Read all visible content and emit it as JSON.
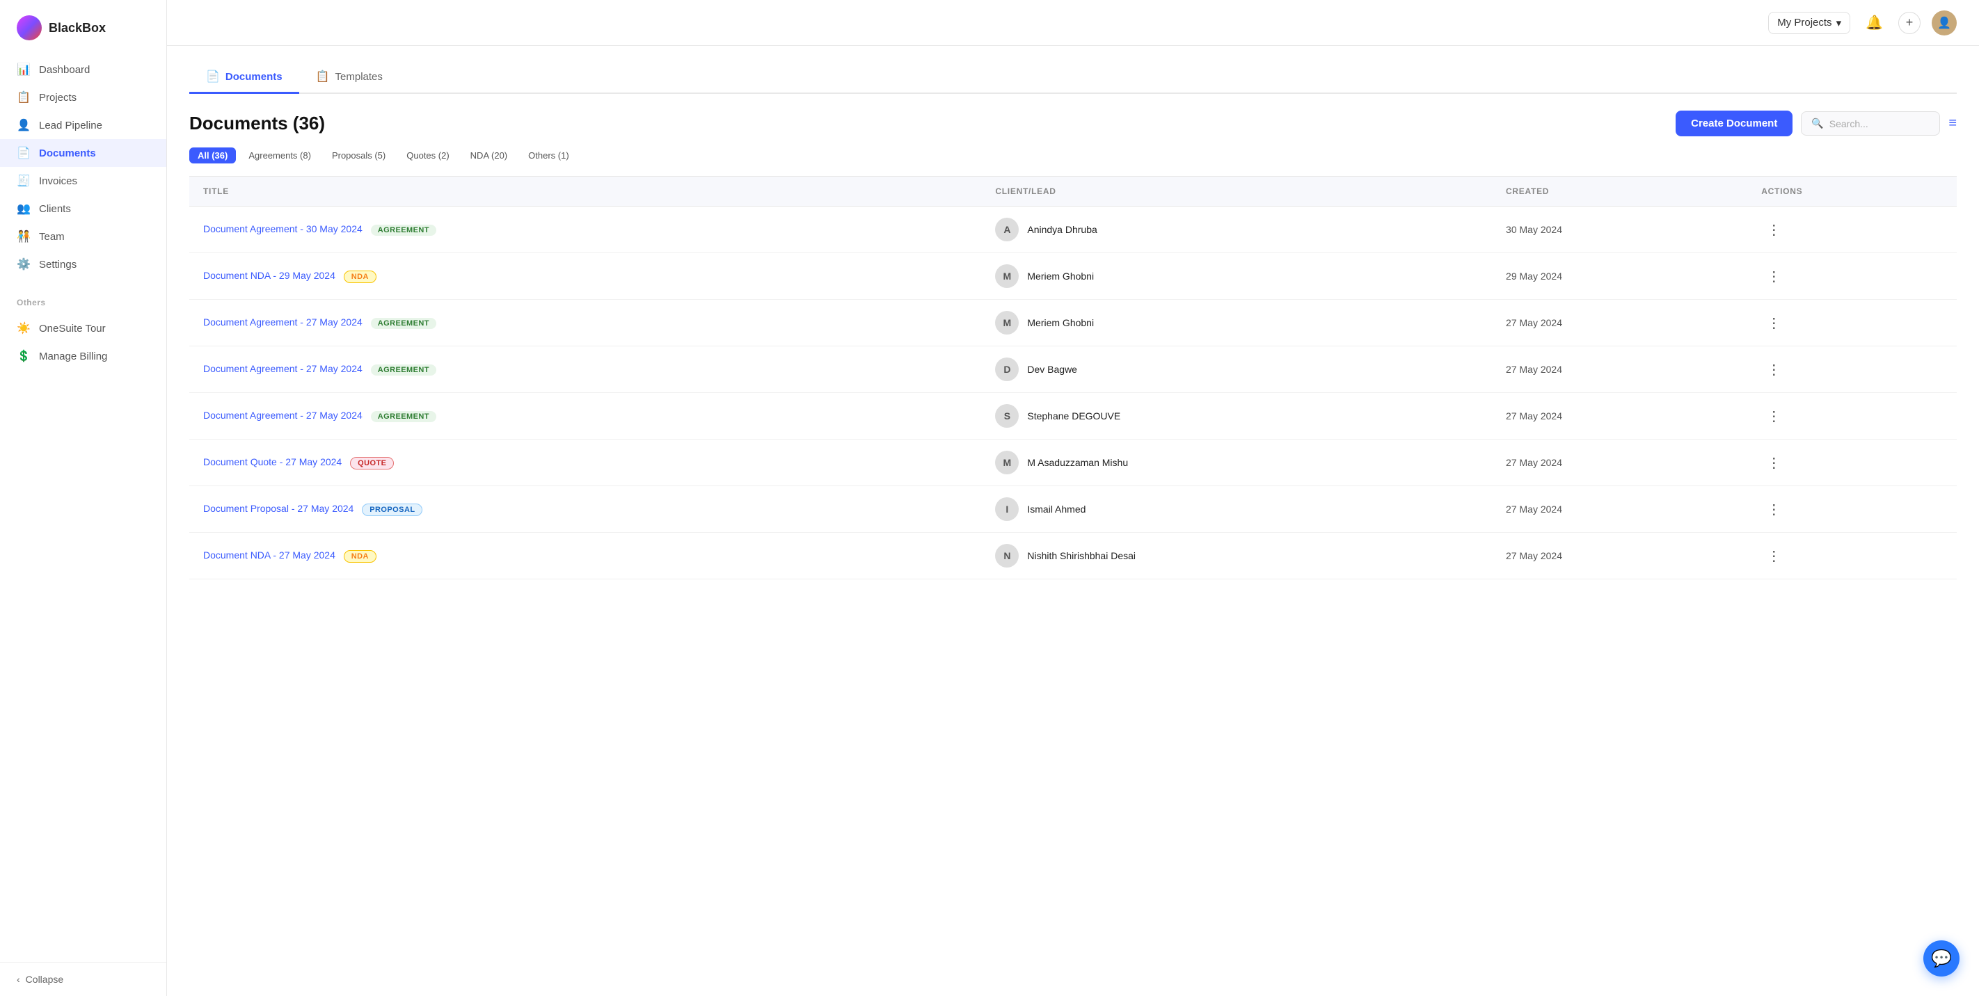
{
  "app": {
    "name": "BlackBox"
  },
  "topbar": {
    "projects_label": "My Projects",
    "chevron": "▾",
    "plus_icon": "+",
    "bell_icon": "🔔"
  },
  "sidebar": {
    "nav_items": [
      {
        "id": "dashboard",
        "label": "Dashboard",
        "icon": "📊",
        "active": false
      },
      {
        "id": "projects",
        "label": "Projects",
        "icon": "📋",
        "active": false
      },
      {
        "id": "lead-pipeline",
        "label": "Lead Pipeline",
        "icon": "👤",
        "active": false
      },
      {
        "id": "documents",
        "label": "Documents",
        "icon": "📄",
        "active": true
      },
      {
        "id": "invoices",
        "label": "Invoices",
        "icon": "🧾",
        "active": false
      },
      {
        "id": "clients",
        "label": "Clients",
        "icon": "👥",
        "active": false
      },
      {
        "id": "team",
        "label": "Team",
        "icon": "🧑‍🤝‍🧑",
        "active": false
      },
      {
        "id": "settings",
        "label": "Settings",
        "icon": "⚙️",
        "active": false
      }
    ],
    "others_label": "Others",
    "others_items": [
      {
        "id": "onesuite-tour",
        "label": "OneSuite Tour",
        "icon": "☀️"
      },
      {
        "id": "manage-billing",
        "label": "Manage Billing",
        "icon": "💲"
      }
    ],
    "collapse_label": "Collapse"
  },
  "tabs": [
    {
      "id": "documents",
      "label": "Documents",
      "icon": "📄",
      "active": true
    },
    {
      "id": "templates",
      "label": "Templates",
      "icon": "📋",
      "active": false
    }
  ],
  "page": {
    "title": "Documents (36)",
    "create_button": "Create Document",
    "search_placeholder": "Search..."
  },
  "filters": [
    {
      "id": "all",
      "label": "All (36)",
      "active": true
    },
    {
      "id": "agreements",
      "label": "Agreements (8)",
      "active": false
    },
    {
      "id": "proposals",
      "label": "Proposals (5)",
      "active": false
    },
    {
      "id": "quotes",
      "label": "Quotes (2)",
      "active": false
    },
    {
      "id": "nda",
      "label": "NDA (20)",
      "active": false
    },
    {
      "id": "others",
      "label": "Others (1)",
      "active": false
    }
  ],
  "table": {
    "columns": [
      {
        "id": "title",
        "label": "TITLE"
      },
      {
        "id": "client",
        "label": "CLIENT/LEAD"
      },
      {
        "id": "created",
        "label": "CREATED"
      },
      {
        "id": "actions",
        "label": "ACTIONS"
      }
    ],
    "rows": [
      {
        "title": "Document Agreement - 30 May 2024",
        "badge": "AGREEMENT",
        "badge_type": "agreement",
        "client_initial": "A",
        "client_name": "Anindya Dhruba",
        "created": "30 May 2024"
      },
      {
        "title": "Document NDA - 29 May 2024",
        "badge": "NDA",
        "badge_type": "nda",
        "client_initial": "M",
        "client_name": "Meriem Ghobni",
        "created": "29 May 2024"
      },
      {
        "title": "Document Agreement - 27 May 2024",
        "badge": "AGREEMENT",
        "badge_type": "agreement",
        "client_initial": "M",
        "client_name": "Meriem Ghobni",
        "created": "27 May 2024"
      },
      {
        "title": "Document Agreement - 27 May 2024",
        "badge": "AGREEMENT",
        "badge_type": "agreement",
        "client_initial": "D",
        "client_name": "Dev Bagwe",
        "created": "27 May 2024"
      },
      {
        "title": "Document Agreement - 27 May 2024",
        "badge": "AGREEMENT",
        "badge_type": "agreement",
        "client_initial": "S",
        "client_name": "Stephane DEGOUVE",
        "created": "27 May 2024"
      },
      {
        "title": "Document Quote - 27 May 2024",
        "badge": "QUOTE",
        "badge_type": "quote",
        "client_initial": "M",
        "client_name": "M Asaduzzaman Mishu",
        "created": "27 May 2024"
      },
      {
        "title": "Document Proposal - 27 May 2024",
        "badge": "PROPOSAL",
        "badge_type": "proposal",
        "client_initial": "I",
        "client_name": "Ismail Ahmed",
        "created": "27 May 2024"
      },
      {
        "title": "Document NDA - 27 May 2024",
        "badge": "NDA",
        "badge_type": "nda",
        "client_initial": "N",
        "client_name": "Nishith Shirishbhai Desai",
        "created": "27 May 2024"
      }
    ]
  }
}
